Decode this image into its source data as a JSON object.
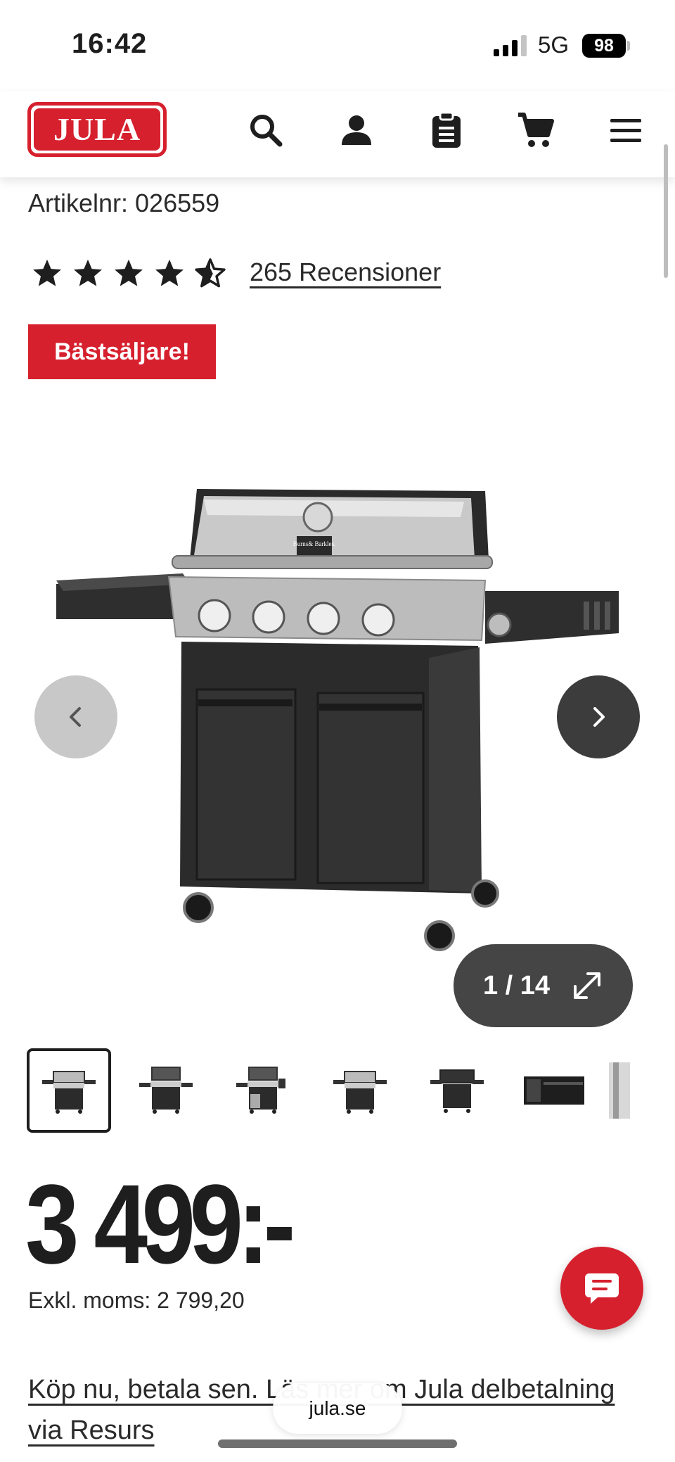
{
  "status_bar": {
    "time": "16:42",
    "network": "5G",
    "battery": "98"
  },
  "header": {
    "logo_text": "JULA",
    "icons": [
      "search-icon",
      "account-icon",
      "list-icon",
      "cart-icon",
      "menu-icon"
    ],
    "brand_color": "#d6202e"
  },
  "product": {
    "article_number": "Artikelnr: 026559",
    "rating": 4.5,
    "reviews_link": "265 Recensioner",
    "badge": "Bästsäljare!",
    "brand_on_image": "Burns& Barkles.",
    "gallery": {
      "counter": "1 / 14",
      "thumbnail_count": 7,
      "active_thumbnail": 1
    },
    "price": "3 499:-",
    "price_ex_vat": "Exkl. moms: 2 799,20",
    "finance_link": "Köp nu, betala sen. Läs mer om Jula delbetalning via Resurs"
  },
  "browser": {
    "url": "jula.se"
  }
}
